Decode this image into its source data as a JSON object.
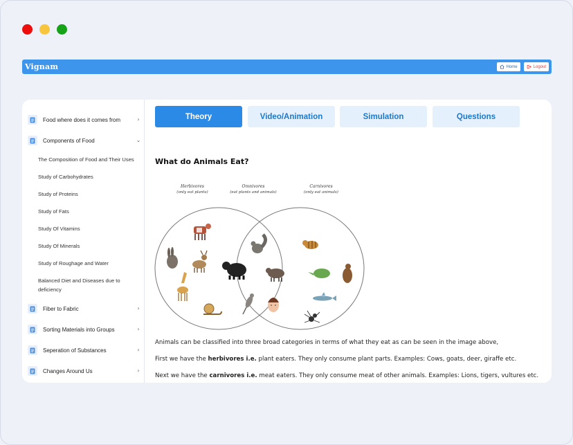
{
  "app": {
    "brand": "Vignam",
    "home_label": "Home",
    "logout_label": "Logout"
  },
  "sidebar": {
    "items": [
      {
        "label": "Food where does it comes from",
        "chevron": "›"
      },
      {
        "label": "Components of Food",
        "chevron": "⌄"
      },
      {
        "label": "Fiber to Fabric",
        "chevron": "›"
      },
      {
        "label": "Sorting Materials into Groups",
        "chevron": "›"
      },
      {
        "label": "Seperation of Substances",
        "chevron": "›"
      },
      {
        "label": "Changes Around Us",
        "chevron": "›"
      }
    ],
    "subitems": [
      "The Composition of Food and Their Uses",
      "Study of Carbohydrates",
      "Study of Proteins",
      "Study of Fats",
      "Study Of Vitamins",
      "Study Of Minerals",
      "Study of Roughage and Water",
      "Balanced Diet and Diseases due to deficiency"
    ]
  },
  "tabs": [
    {
      "label": "Theory",
      "active": true
    },
    {
      "label": "Video/Animation",
      "active": false
    },
    {
      "label": "Simulation",
      "active": false
    },
    {
      "label": "Questions",
      "active": false
    }
  ],
  "main": {
    "heading": "What do Animals Eat?",
    "venn": {
      "herbivores_title": "Herbivores",
      "herbivores_sub": "(only eat plants)",
      "omnivores_title": "Omnivores",
      "omnivores_sub": "(eat plants and animals)",
      "carnivores_title": "Carnivores",
      "carnivores_sub": "(only eat animals)"
    },
    "para1": "Animals can be classified into three broad categories in terms of what they eat as can be seen in the image above,",
    "para2_pre": "First we have the ",
    "para2_bold": "herbivores i.e.",
    "para2_post": " plant eaters. They only consume plant parts. Examples: Cows, goats, deer, giraffe etc.",
    "para3_pre": "Next we have the ",
    "para3_bold": "carnivores i.e.",
    "para3_post": " meat eaters. They only consume meat of other animals. Examples: Lions, tigers, vultures etc."
  },
  "colors": {
    "accent": "#2a8ae5",
    "topbar": "#3d96eb",
    "tab_inactive_bg": "#e4f1fd",
    "logout": "#e53e3e"
  }
}
